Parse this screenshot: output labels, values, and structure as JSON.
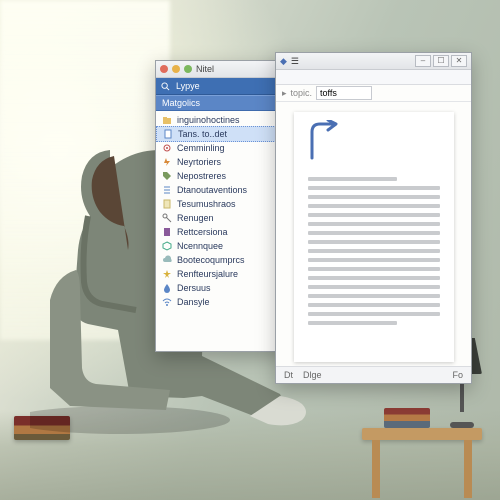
{
  "explorer": {
    "title": "Nitel",
    "toolbar_label": "Lypye",
    "sections": [
      {
        "label": "Matgolics",
        "items": [
          {
            "icon": "folder",
            "label": "inguinohoctines"
          },
          {
            "icon": "doc",
            "label": "Tans. to..det",
            "selected": true
          },
          {
            "icon": "gear",
            "label": "Cemminling"
          },
          {
            "icon": "bolt",
            "label": "Neyrtoriers"
          },
          {
            "icon": "tag",
            "label": "Nepostreres"
          },
          {
            "icon": "list",
            "label": "Dtanoutaventions"
          },
          {
            "icon": "note",
            "label": "Tesumushraos"
          },
          {
            "icon": "key",
            "label": "Renugen"
          },
          {
            "icon": "book",
            "label": "Rettcersiona"
          },
          {
            "icon": "cube",
            "label": "Ncennquee"
          },
          {
            "icon": "cloud",
            "label": "Bootecoqumprcs"
          },
          {
            "icon": "star",
            "label": "Renfteursjalure"
          },
          {
            "icon": "drop",
            "label": "Dersuus"
          },
          {
            "icon": "wifi",
            "label": "Dansyle"
          }
        ]
      }
    ]
  },
  "editor": {
    "menu": [
      "◆",
      "☰"
    ],
    "win_buttons": [
      "–",
      "☐",
      "✕"
    ],
    "crumb_label": "topic.",
    "field_value": "toffs",
    "status": {
      "left": "Dt",
      "mid": "Dlge",
      "right": "Fo"
    }
  }
}
